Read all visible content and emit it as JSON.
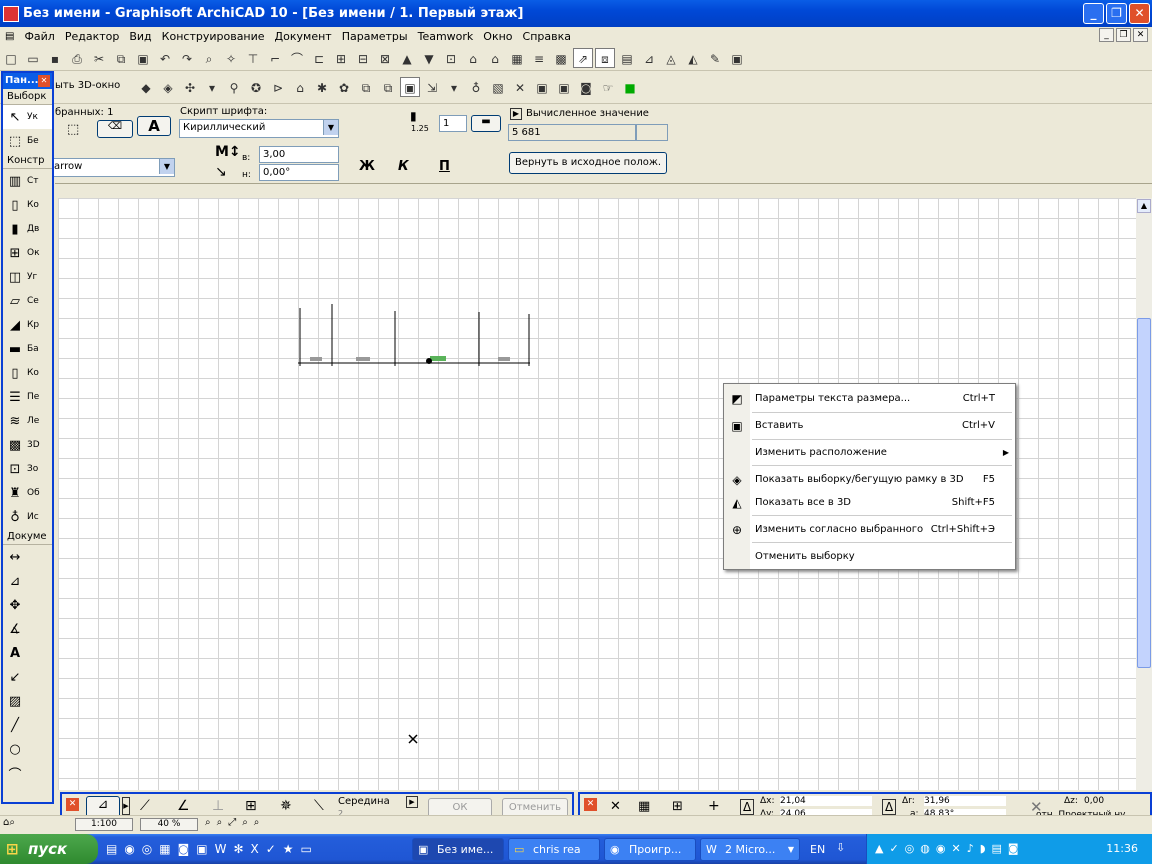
{
  "window": {
    "title": "Без имени - Graphisoft ArchiCAD 10 - [Без имени / 1. Первый этаж]"
  },
  "menu": [
    "Файл",
    "Редактор",
    "Вид",
    "Конструирование",
    "Документ",
    "Параметры",
    "Teamwork",
    "Окно",
    "Справка"
  ],
  "toolbar2": {
    "view3d_label": "ыть 3D-окно"
  },
  "info": {
    "selected_label": "бранных: 1",
    "script_label": "Скрипт шрифта:",
    "script_value": "Кириллический",
    "font_value": "arrow",
    "pen_scale": "1.25",
    "pen_value": "1",
    "height_prefix": "в:",
    "height_value": "3,00",
    "angle_prefix": "н:",
    "angle_value": "0,00°",
    "bold": "Ж",
    "italic": "К",
    "underline": "П",
    "computed_label": "Вычисленное значение",
    "computed_value": "5 681",
    "reset_button": "Вернуть в исходное полож."
  },
  "palette": {
    "title": "Пан...",
    "sec_select": "Выборк",
    "items_select": [
      {
        "label": "Ук"
      },
      {
        "label": "Бе"
      }
    ],
    "sec_construct": "Констр",
    "items_construct": [
      {
        "label": "Ст"
      },
      {
        "label": "Ко"
      },
      {
        "label": "Дв"
      },
      {
        "label": "Ок"
      },
      {
        "label": "Уг"
      },
      {
        "label": "Се"
      },
      {
        "label": "Кр"
      },
      {
        "label": "Ба"
      },
      {
        "label": "Ко"
      },
      {
        "label": "Пе"
      },
      {
        "label": "Ле"
      },
      {
        "label": "3D"
      },
      {
        "label": "Зо"
      },
      {
        "label": "Об"
      },
      {
        "label": "Ис"
      }
    ],
    "sec_document": "Докуме"
  },
  "context_menu": [
    {
      "label": "Параметры текста размера...",
      "shortcut": "Ctrl+T",
      "icon": "text-params-icon"
    },
    {
      "label": "Вставить",
      "shortcut": "Ctrl+V",
      "icon": "paste-icon"
    },
    {
      "label": "Изменить расположение",
      "shortcut": "",
      "icon": "",
      "submenu": true
    },
    {
      "label": "Показать выборку/бегущую рамку в 3D",
      "shortcut": "F5",
      "icon": "show-3d-icon"
    },
    {
      "label": "Показать все в 3D",
      "shortcut": "Shift+F5",
      "icon": "show-all-3d-icon"
    },
    {
      "label": "Изменить согласно выбранного",
      "shortcut": "Ctrl+Shift+Э",
      "icon": "modify-icon"
    },
    {
      "label": "Отменить выборку",
      "shortcut": "",
      "icon": ""
    }
  ],
  "control_box": {
    "mode": "Середина",
    "mode_num": "2",
    "ok": "ОК",
    "cancel": "Отменить"
  },
  "coords": {
    "dx_label": "Δx:",
    "dx": "21,04",
    "dy_label": "Δy:",
    "dy": "24,06",
    "dr_label": "Δr:",
    "dr": "31,96",
    "a_label": "a:",
    "a": "48,83°",
    "dz_label": "Δz:",
    "dz": "0,00",
    "ref": "отн. Проектный ну"
  },
  "status": {
    "scale": "1:100",
    "zoom": "40 %"
  },
  "taskbar": {
    "start": "пуск",
    "buttons": [
      "Без име...",
      "chris rea",
      "Проигр...",
      "2 Micro..."
    ],
    "lang": "EN",
    "time": "11:36"
  }
}
